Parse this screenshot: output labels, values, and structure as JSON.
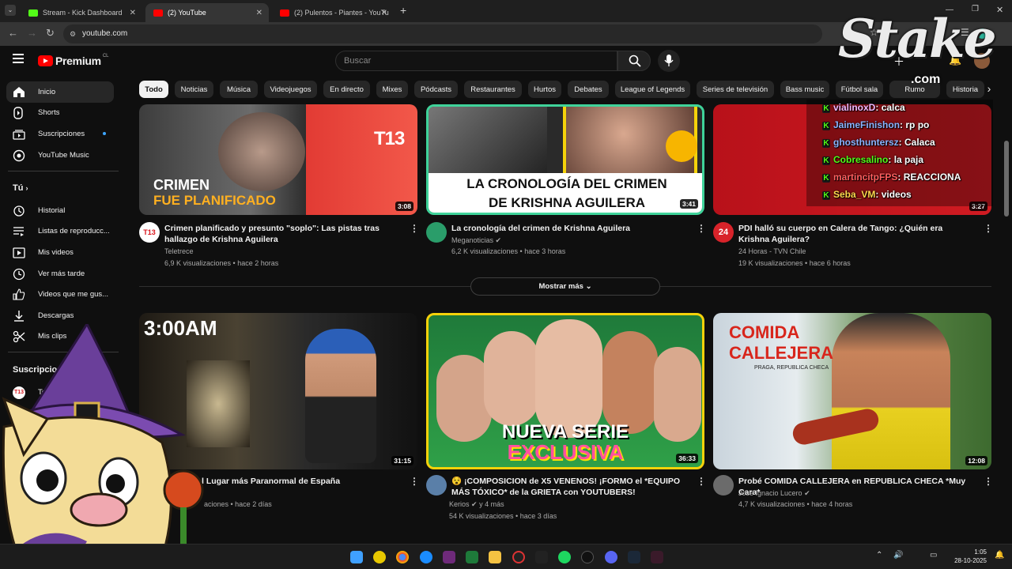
{
  "browser": {
    "tabs": [
      {
        "title": "Stream - Kick Dashboard",
        "favicon": "kick-icon",
        "color": "#53fc18"
      },
      {
        "title": "(2) YouTube",
        "favicon": "youtube-icon",
        "color": "#ff0000"
      },
      {
        "title": "(2) Pulentos - Piantes - YouTube",
        "favicon": "youtube-icon",
        "color": "#ff0000"
      }
    ],
    "url": "youtube.com"
  },
  "header": {
    "logo_text": "Premium",
    "logo_region": "CL",
    "search_placeholder": "Buscar"
  },
  "sidebar": {
    "items": [
      {
        "label": "Inicio",
        "icon": "home-icon",
        "active": true
      },
      {
        "label": "Shorts",
        "icon": "shorts-icon"
      },
      {
        "label": "Suscripciones",
        "icon": "subscriptions-icon"
      },
      {
        "label": "YouTube Music",
        "icon": "music-icon"
      }
    ],
    "you_heading": "Tú",
    "you_items": [
      {
        "label": "Historial",
        "icon": "history-icon"
      },
      {
        "label": "Listas de reproducc...",
        "icon": "playlist-icon"
      },
      {
        "label": "Mis videos",
        "icon": "my-videos-icon"
      },
      {
        "label": "Ver más tarde",
        "icon": "clock-icon"
      },
      {
        "label": "Videos que me gus...",
        "icon": "like-icon"
      },
      {
        "label": "Descargas",
        "icon": "download-icon"
      },
      {
        "label": "Mis clips",
        "icon": "scissors-icon"
      }
    ],
    "subs_heading": "Suscripciones",
    "subs_first": "Teletrece"
  },
  "chips": [
    "Todo",
    "Noticias",
    "Música",
    "Videojuegos",
    "En directo",
    "Mixes",
    "Pódcasts",
    "Restaurantes",
    "Hurtos",
    "Debates",
    "League of Legends",
    "Series de televisión",
    "Bass music",
    "Fútbol sala",
    "Rumo",
    "Historia"
  ],
  "videos_row1": [
    {
      "title": "Crimen planificado y presunto \"soplo\": Las pistas tras hallazgo de Krishna Aguilera",
      "channel": "Teletrece",
      "stats": "6,9 K visualizaciones • hace 2 horas",
      "duration": "3:08",
      "thumb_text1": "CRIMEN",
      "thumb_text2": "FUE PLANIFICADO",
      "thumb_badge": "T13"
    },
    {
      "title": "La cronología del crimen de Krishna Aguilera",
      "channel": "Meganoticias",
      "stats": "6,2 K visualizaciones • hace 3 horas",
      "duration": "3:41",
      "thumb_text1": "LA CRONOLOGÍA DEL CRIMEN",
      "thumb_text2": "DE KRISHNA AGUILERA"
    },
    {
      "title": "PDI halló su cuerpo en Calera de Tango: ¿Quién era Krishna Aguilera?",
      "channel": "24 Horas - TVN Chile",
      "stats": "19 K visualizaciones • hace 6 horas",
      "duration": "3:27",
      "avatar_text": "24"
    }
  ],
  "show_more": "Mostrar más",
  "videos_row2": [
    {
      "title": "l Lugar más Paranormal de España",
      "channel": "",
      "stats": "aciones • hace 2 días",
      "duration": "31:15",
      "thumb_text1": "3:00AM"
    },
    {
      "title": "😵 ¡COMPOSICION de X5 VENENOS! ¡FORMO el *EQUIPO MÁS TÓXICO* de la GRIETA con YOUTUBERS!",
      "channel": "Kerios",
      "channel_extra": "y 4 más",
      "stats": "54 K visualizaciones • hace 3 días",
      "duration": "36:33",
      "thumb_text1": "NUEVA SERIE",
      "thumb_text2": "EXCLUSIVA"
    },
    {
      "title": "Probé COMIDA CALLEJERA en REPUBLICA CHECA *Muy Cara*",
      "channel": "Jose Ignacio Lucero",
      "stats": "4,7 K visualizaciones • hace 4 horas",
      "duration": "12:08",
      "thumb_text1": "COMIDA",
      "thumb_text2": "CALLEJERA",
      "thumb_text3": "PRAGA, REPUBLICA CHECA"
    }
  ],
  "chat": [
    {
      "user": "vialinoxD",
      "msg": ": calca",
      "color": "#f2b8ff"
    },
    {
      "user": "JaimeFinishon",
      "msg": ": rp po",
      "color": "#8ab4ff"
    },
    {
      "user": "ghosthuntersz",
      "msg": ": Calaca",
      "color": "#8ab4ff"
    },
    {
      "user": "Cobresalino",
      "msg": ": la paja",
      "color": "#53fc18"
    },
    {
      "user": "martincitpFPS",
      "msg": ": REACCIONA",
      "color": "#ff5f5f"
    },
    {
      "user": "Seba_VM",
      "msg": ": videos",
      "color": "#ffd84d"
    }
  ],
  "overlay": {
    "brand": "Stake",
    "brand_sub": ".com"
  },
  "taskbar": {
    "time": "1:05",
    "date": "28-10-2025"
  }
}
